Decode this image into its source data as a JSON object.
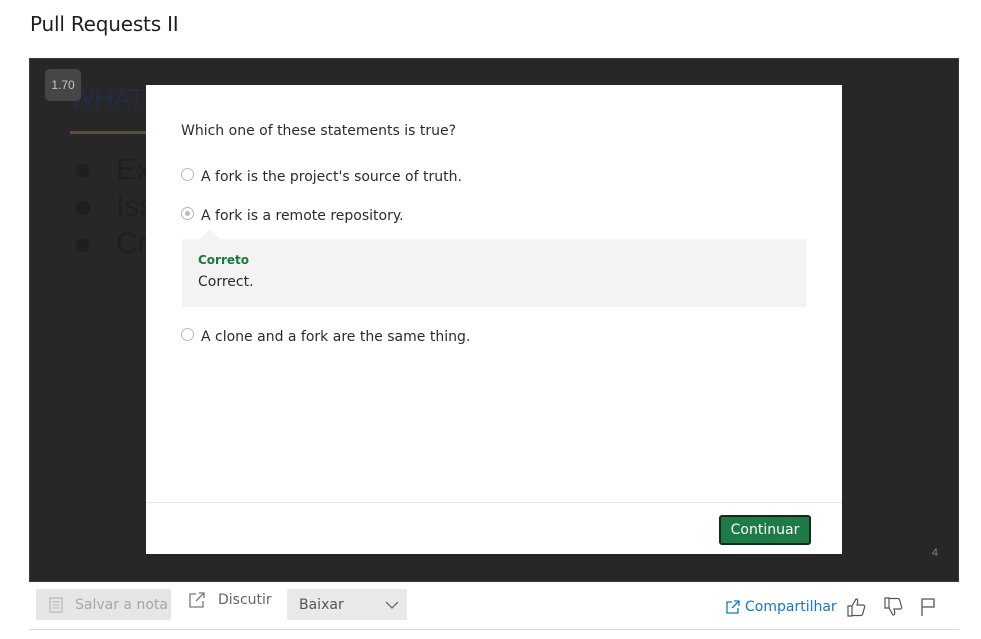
{
  "page": {
    "title": "Pull Requests II"
  },
  "slide": {
    "speed": "1.70",
    "heading": "WHAT",
    "bullets": [
      "Ex",
      "Iss",
      "Cr"
    ],
    "page_number": "4"
  },
  "quiz": {
    "question": "Which one of these statements is true?",
    "options": [
      {
        "label": "A fork is the project's source of truth.",
        "selected": false
      },
      {
        "label": "A fork is a remote repository.",
        "selected": true
      },
      {
        "label": "A clone and a fork are the same thing.",
        "selected": false
      }
    ],
    "feedback": {
      "title": "Correto",
      "text": "Correct."
    },
    "continue_label": "Continuar",
    "accent_color": "#1e7a47"
  },
  "toolbar": {
    "save_note_label": "Salvar a nota",
    "discuss_label": "Discutir",
    "download_label": "Baixar",
    "share_label": "Compartilhar",
    "icons": [
      "note-icon",
      "external-link-icon",
      "chevron-down-icon",
      "share-icon",
      "thumbs-up-icon",
      "thumbs-down-icon",
      "flag-icon"
    ]
  }
}
